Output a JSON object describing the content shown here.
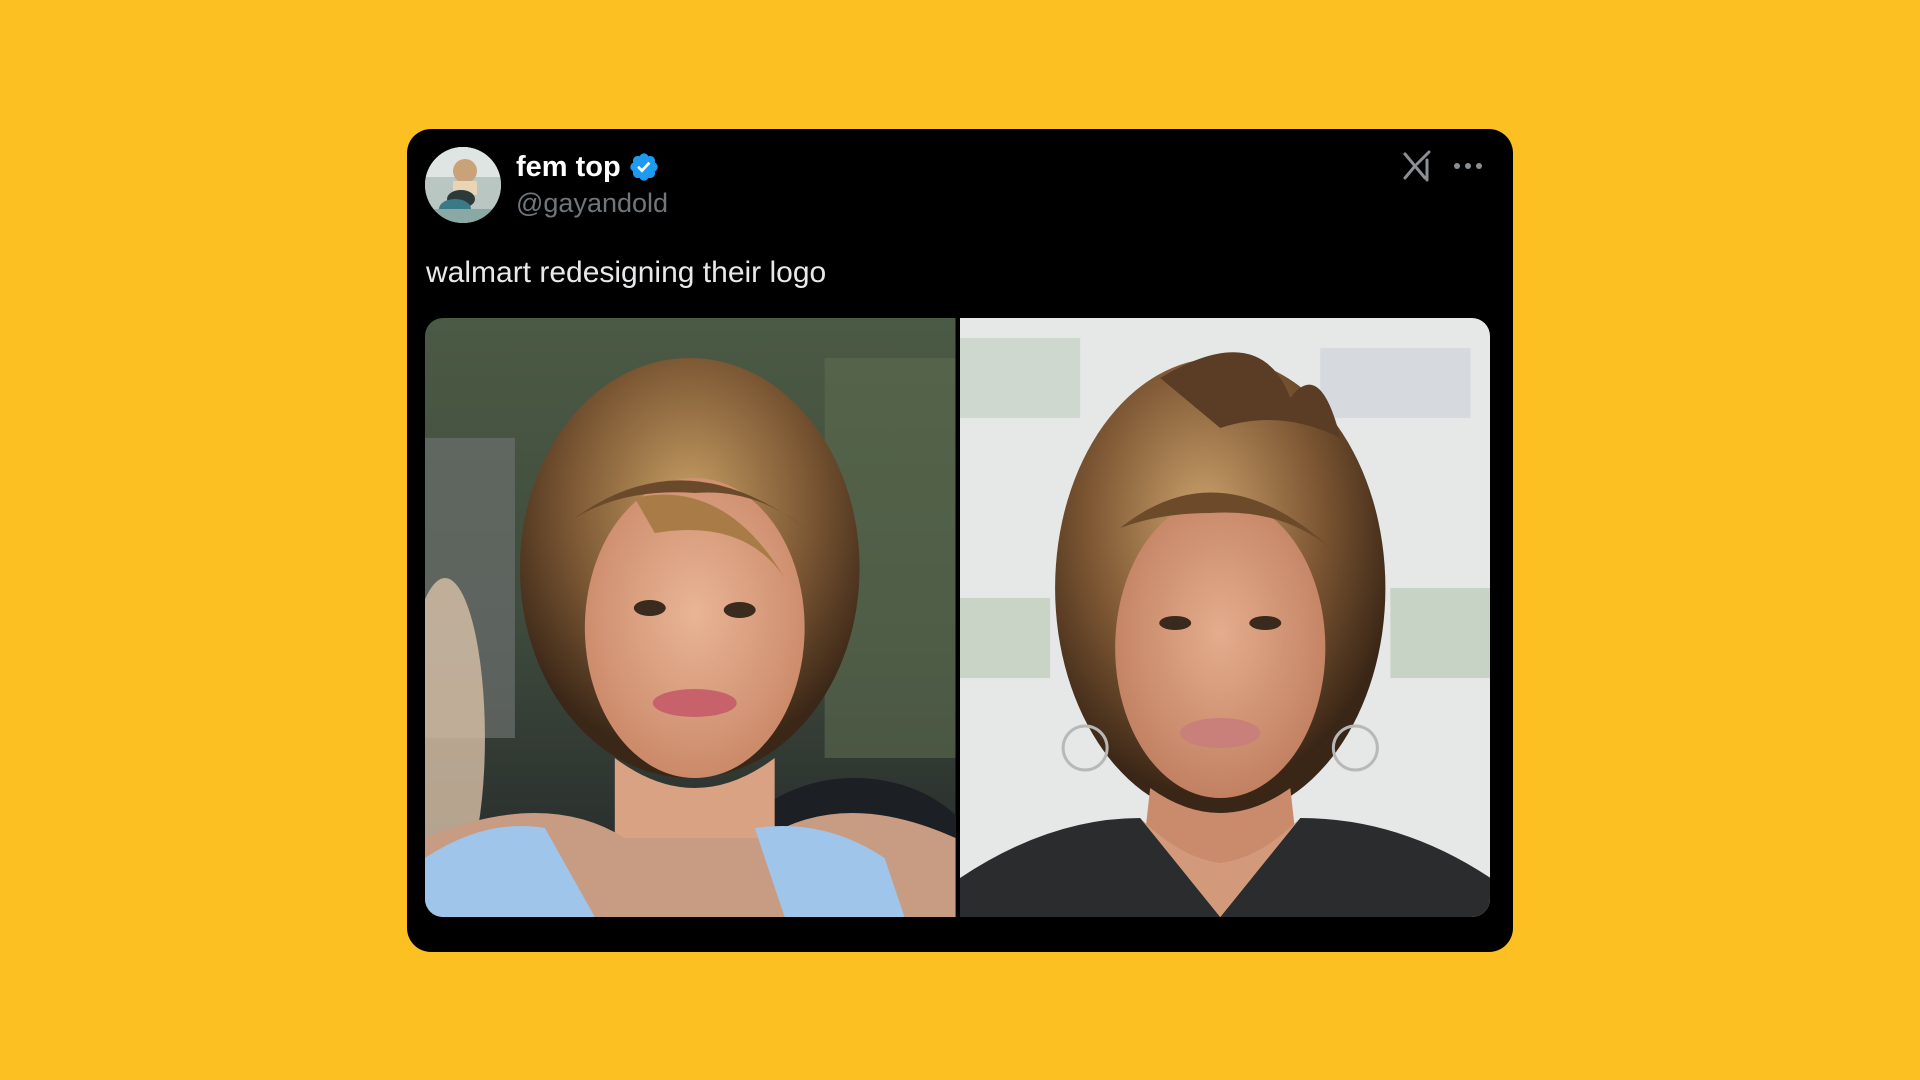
{
  "tweet": {
    "author": {
      "display_name": "fem top",
      "handle": "@gayandold",
      "verified": true,
      "avatar_icon": "avatar-photo"
    },
    "text": "walmart redesigning their logo",
    "header_icons": [
      "x-logo-icon",
      "more-icon"
    ],
    "media": [
      {
        "name": "photo-left",
        "description_icon": "photo-left"
      },
      {
        "name": "photo-right",
        "description_icon": "photo-right"
      }
    ]
  },
  "colors": {
    "background": "#FDC023",
    "card": "#000000",
    "name": "#ffffff",
    "handle": "#71767b",
    "text": "#e7e9ea",
    "verified": "#1d9bf0"
  }
}
